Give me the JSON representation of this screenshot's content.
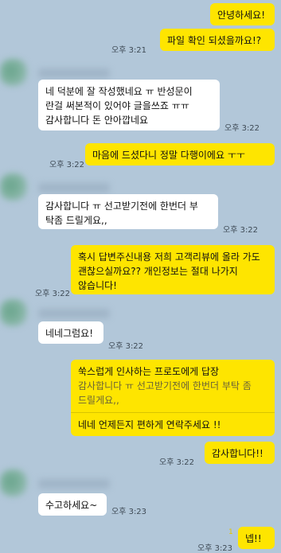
{
  "messages": [
    {
      "id": "m1",
      "sender": "me",
      "text": "안녕하세요!",
      "time": ""
    },
    {
      "id": "m2",
      "sender": "me",
      "text": "파일 확인 되셨을까요!?",
      "time": "오후 3:21"
    },
    {
      "id": "m3",
      "sender": "them",
      "text": "네 덕분에 잘 작성했네요 ㅠ 반성문이 란걸 써본적이 있어야 글을쓰죠 ㅠㅠ 감사합니다 돈 안아깝네요",
      "time": "오후 3:22"
    },
    {
      "id": "m4",
      "sender": "me",
      "text": "마음에 드셨다니 정말 다행이에요 ㅜㅜ",
      "time": "오후 3:22"
    },
    {
      "id": "m5",
      "sender": "them",
      "text": "감사합니다 ㅠ 선고받기전에 한번더 부 탁좀 드릴게요,,",
      "time": "오후 3:22"
    },
    {
      "id": "m6",
      "sender": "me",
      "text": "혹시 답변주신내용 저희 고객리뷰에 올라 가도 괜찮으실까요?? 개인정보는 절대 나가지 않습니다!",
      "time": "오후 3:22"
    },
    {
      "id": "m7",
      "sender": "them",
      "text": "네네그럼요!",
      "time": "오후 3:22"
    },
    {
      "id": "m8",
      "sender": "me",
      "reply_title": "쑥스럽게 인사하는 프로도에게 답장",
      "reply_quote": "감사합니다 ㅠ 선고받기전에 한번더 부탁 좀 드릴게요,,",
      "text": "네네 언제든지 편하게 연락주세요 !!",
      "time": ""
    },
    {
      "id": "m9",
      "sender": "me",
      "text": "감사합니다!!",
      "time": "오후 3:22"
    },
    {
      "id": "m10",
      "sender": "them",
      "text": "수고하세요~",
      "time": "오후 3:23"
    },
    {
      "id": "m11",
      "sender": "me",
      "text": "넵!!",
      "time": "오후 3:23",
      "unread": "1"
    }
  ],
  "colors": {
    "background": "#b2c7d9",
    "my_bubble": "#fee500",
    "their_bubble": "#ffffff"
  }
}
